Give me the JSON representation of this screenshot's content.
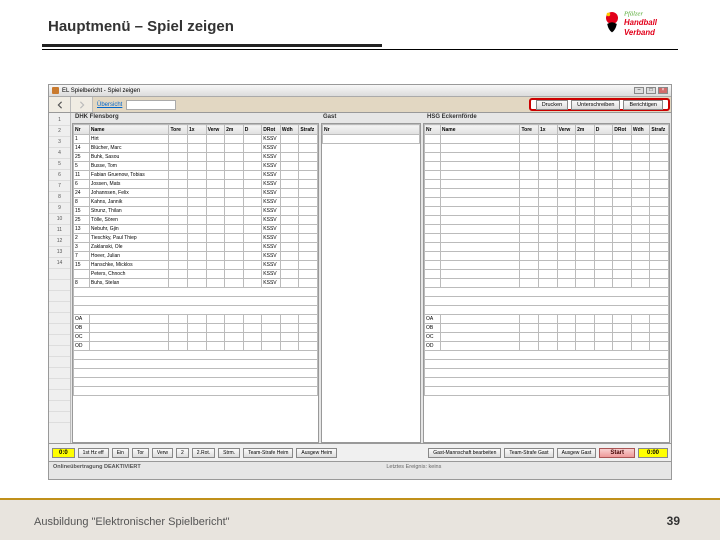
{
  "slide": {
    "title": "Hauptmenü – Spiel zeigen",
    "footer": "Ausbildung \"Elektronischer Spielbericht\"",
    "page": "39"
  },
  "logo": {
    "line1": "Pfälzer",
    "line2": "Handball",
    "line3": "Verband"
  },
  "window": {
    "title": "EL Spielbericht - Spiel zeigen"
  },
  "nav": {
    "link": "Übersicht",
    "btn1": "Drucken",
    "btn2": "Unterschreiben",
    "btn3": "Berichtigen"
  },
  "side": [
    "1",
    "2",
    "3",
    "4",
    "5",
    "6",
    "7",
    "8",
    "9",
    "10",
    "11",
    "12",
    "13",
    "14",
    "",
    "",
    "",
    "",
    "",
    "",
    "",
    "",
    "",
    "",
    "",
    "",
    "",
    ""
  ],
  "teams": {
    "home": "DHK Flensborg",
    "mid": "Gast",
    "away": "HSG Eckernförde"
  },
  "cols": {
    "nr": "Nr",
    "name": "Name",
    "tore": "Tore",
    "w1": "1x",
    "w2": "Verw",
    "w3": "2m",
    "w4": "D",
    "w5": "DRot",
    "w6": "Wdh",
    "w7": "Strafz"
  },
  "home_players": [
    {
      "nr": "1",
      "name": "Hirt",
      "club": "KSSV"
    },
    {
      "nr": "14",
      "name": "Blücher, Marc",
      "club": "KSSV"
    },
    {
      "nr": "25",
      "name": "Buhk, Sasou",
      "club": "KSSV"
    },
    {
      "nr": "5",
      "name": "Busse, Tom",
      "club": "KSSV"
    },
    {
      "nr": "11",
      "name": "Fabian Gruenow, Tobias",
      "club": "KSSV"
    },
    {
      "nr": "6",
      "name": "Jossen, Mats",
      "club": "KSSV"
    },
    {
      "nr": "24",
      "name": "Johannsen, Felix",
      "club": "KSSV"
    },
    {
      "nr": "8",
      "name": "Kahns, Jannik",
      "club": "KSSV"
    },
    {
      "nr": "15",
      "name": "Strunz, Thilan",
      "club": "KSSV"
    },
    {
      "nr": "25",
      "name": "Tölle, Sören",
      "club": "KSSV"
    },
    {
      "nr": "13",
      "name": "Nebuhr, Gjin",
      "club": "KSSV"
    },
    {
      "nr": "2",
      "name": "Tieschky, Paul Thiep",
      "club": "KSSV"
    },
    {
      "nr": "3",
      "name": "Zaklanski, Ole",
      "club": "KSSV"
    },
    {
      "nr": "7",
      "name": "Hoeer, Julian",
      "club": "KSSV"
    },
    {
      "nr": "15",
      "name": "Hanschke, Micklos",
      "club": "KSSV"
    },
    {
      "nr": "",
      "name": "Peters, Chnoch",
      "club": "KSSV"
    },
    {
      "nr": "8",
      "name": "Buhs, Stelan",
      "club": "KSSV"
    }
  ],
  "officials": [
    "OA",
    "OB",
    "OC",
    "OD"
  ],
  "bottom": {
    "clock1": "0:0",
    "b1": "1st Hz eff",
    "b2": "Ein",
    "b3": "Tor",
    "b4": "Verw",
    "b5": "2",
    "b6": "2.Rot.",
    "b7": "Strm.",
    "team_btn": "Team-Strafe Heim",
    "assign": "Ausgew Heim",
    "guest_edit": "Gast-Mannschaft bearbeiten",
    "team_guest": "Team-Strafe Gast",
    "assign_g": "Ausgew Gast",
    "start": "Start",
    "clock2": "0:00"
  },
  "status": {
    "left": "Onlineübertragung DEAKTIVIERT",
    "mid": "Letztes Ereignis: keins"
  }
}
